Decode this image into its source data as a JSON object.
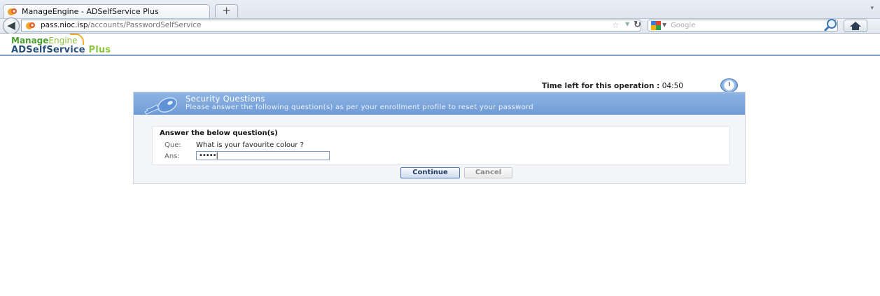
{
  "browser": {
    "tab_title": "ManageEngine - ADSelfService Plus",
    "new_tab_label": "+",
    "url_host": "pass.nioc.isp",
    "url_path": "/accounts/PasswordSelfService",
    "search_placeholder": "Google"
  },
  "header": {
    "logo_manage": "Manage",
    "logo_engine": "Engine",
    "logo_product": "ADSelfService",
    "logo_plus": "Plus"
  },
  "timer": {
    "label": "Time left for this operation :",
    "value": "04:50"
  },
  "panel": {
    "title": "Security Questions",
    "subtitle": "Please answer the following question(s) as per your enrollment profile to reset your password",
    "box_heading": "Answer the below question(s)",
    "question_label": "Que:",
    "question_text": "What is your favourite colour ?",
    "answer_label": "Ans:",
    "answer_value": "•••••|",
    "continue_label": "Continue",
    "cancel_label": "Cancel"
  },
  "colors": {
    "panel_header": "#7aa3dc",
    "header_rule": "#7fa0c7",
    "brand_green": "#4c9f2f",
    "brand_blue": "#27507c"
  }
}
